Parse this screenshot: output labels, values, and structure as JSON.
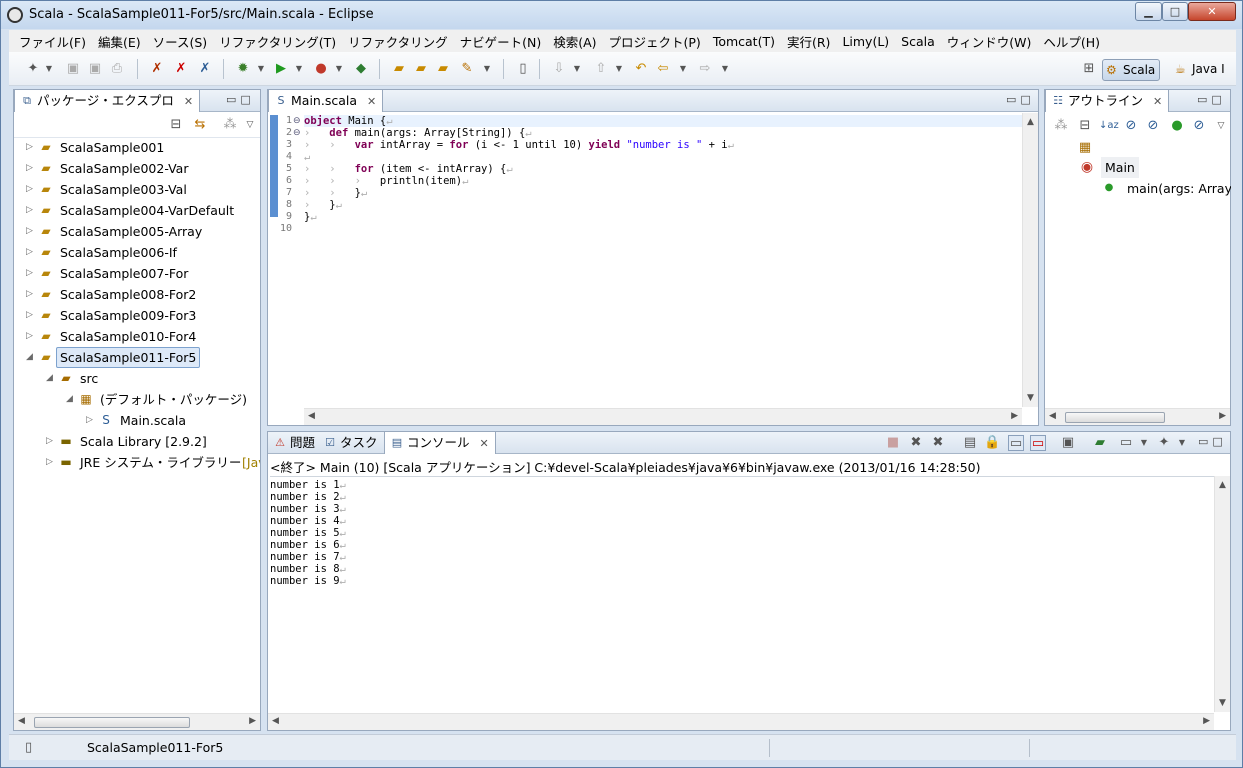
{
  "window": {
    "title": "Scala - ScalaSample011-For5/src/Main.scala - Eclipse",
    "minimize": "▁",
    "maximize": "□",
    "close": "✕"
  },
  "menubar": [
    "ファイル(F)",
    "編集(E)",
    "ソース(S)",
    "リファクタリング(T)",
    "リファクタリング",
    "ナビゲート(N)",
    "検索(A)",
    "プロジェクト(P)",
    "Tomcat(T)",
    "実行(R)",
    "Limy(L)",
    "Scala",
    "ウィンドウ(W)",
    "ヘルプ(H)"
  ],
  "perspectives": {
    "scala": "Scala",
    "java": "Java I"
  },
  "package_explorer": {
    "title": "パッケージ・エクスプロ",
    "projects": [
      "ScalaSample001",
      "ScalaSample002-Var",
      "ScalaSample003-Val",
      "ScalaSample004-VarDefault",
      "ScalaSample005-Array",
      "ScalaSample006-If",
      "ScalaSample007-For",
      "ScalaSample008-For2",
      "ScalaSample009-For3",
      "ScalaSample010-For4",
      "ScalaSample011-For5"
    ],
    "src": "src",
    "default_package": "(デフォルト・パッケージ)",
    "main_file": "Main.scala",
    "scala_library": "Scala Library [2.9.2]",
    "jre_prefix": "JRE システム・ライブラリー ",
    "jre_suffix": "[Jav"
  },
  "editor": {
    "tab": "Main.scala",
    "line_numbers": [
      "1",
      "2",
      "3",
      "4",
      "5",
      "6",
      "7",
      "8",
      "9",
      "10"
    ],
    "code": {
      "l1_kw": "object",
      "l1_rest": " Main {",
      "l2_kw": "def",
      "l2_rest": " main(args: Array[String]) {",
      "l3_var": "var",
      "l3_mid": " intArray = ",
      "l3_for": "for",
      "l3_mid2": " (i <- 1 until 10) ",
      "l3_yield": "yield",
      "l3_sp": " ",
      "l3_str": "\"number is \"",
      "l3_end": " + i",
      "l5_for": "for",
      "l5_rest": " (item <- intArray) {",
      "l6": "println(item)",
      "l7": "}",
      "l8": "}",
      "l9": "}"
    },
    "pilcrow": "↵",
    "tab_glyph": "›"
  },
  "outline": {
    "title": "アウトライン",
    "object": "Main",
    "method": "main(args: Array|"
  },
  "console": {
    "tabs": {
      "problems": "問題",
      "tasks": "タスク",
      "console": "コンソール"
    },
    "description": "<終了> Main (10) [Scala アプリケーション] C:¥devel-Scala¥pleiades¥java¥6¥bin¥javaw.exe (2013/01/16 14:28:50)",
    "output": [
      "number is 1",
      "number is 2",
      "number is 3",
      "number is 4",
      "number is 5",
      "number is 6",
      "number is 7",
      "number is 8",
      "number is 9"
    ]
  },
  "statusbar": {
    "selection": "ScalaSample011-For5"
  }
}
